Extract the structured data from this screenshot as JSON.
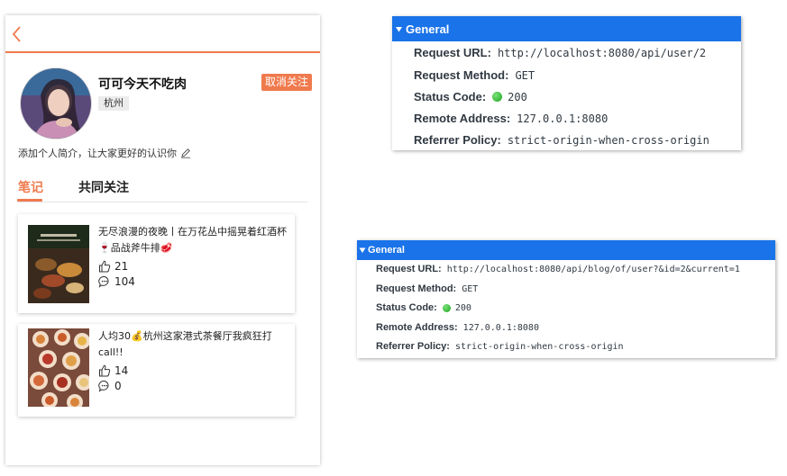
{
  "profile": {
    "username": "可可今天不吃肉",
    "city": "杭州",
    "unfollow_label": "取消关注",
    "intro": "添加个人简介，让大家更好的认识你",
    "accent_color": "#ef7a4d"
  },
  "tabs": [
    {
      "label": "笔记",
      "active": true
    },
    {
      "label": "共同关注",
      "active": false
    }
  ],
  "notes": [
    {
      "title": "无尽浪漫的夜晚丨在万花丛中摇晃着红酒杯🍷品战斧牛排🥩",
      "likes": "21",
      "comments": "104"
    },
    {
      "title": "人均30💰杭州这家港式茶餐厅我疯狂打call!!",
      "likes": "14",
      "comments": "0"
    }
  ],
  "request_user": {
    "header": "General",
    "rows": [
      {
        "key": "Request URL:",
        "value": "http://localhost:8080/api/user/2"
      },
      {
        "key": "Request Method:",
        "value": "GET"
      },
      {
        "key": "Status Code:",
        "value": "200"
      },
      {
        "key": "Remote Address:",
        "value": "127.0.0.1:8080"
      },
      {
        "key": "Referrer Policy:",
        "value": "strict-origin-when-cross-origin"
      }
    ]
  },
  "request_blog": {
    "header": "General",
    "rows": [
      {
        "key": "Request URL:",
        "value": "http://localhost:8080/api/blog/of/user?&id=2&current=1"
      },
      {
        "key": "Request Method:",
        "value": "GET"
      },
      {
        "key": "Status Code:",
        "value": "200"
      },
      {
        "key": "Remote Address:",
        "value": "127.0.0.1:8080"
      },
      {
        "key": "Referrer Policy:",
        "value": "strict-origin-when-cross-origin"
      }
    ]
  },
  "colors": {
    "devtools_header": "#1a73e8",
    "status_ok": "#1aa51a"
  },
  "icons": [
    "back-arrow-icon",
    "edit-pencil-icon",
    "thumbs-up-icon",
    "comment-icon",
    "status-ok-icon",
    "expand-triangle-icon"
  ]
}
